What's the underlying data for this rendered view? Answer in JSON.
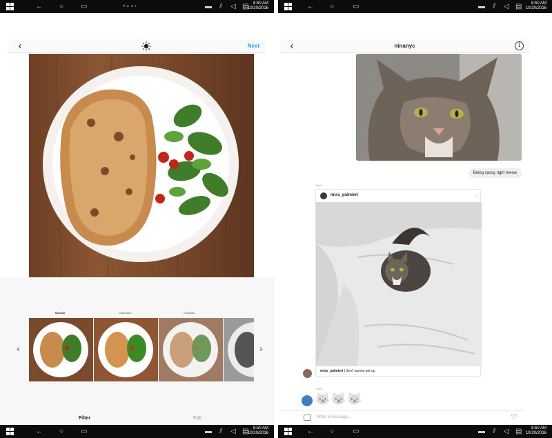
{
  "left_screen": {
    "taskbar_top": {
      "time": "8:50 AM",
      "date": "10/20/2016"
    },
    "taskbar_bottom": {
      "time": "8:50 AM",
      "date": "10/20/2016"
    },
    "header": {
      "back_icon": "chevron-left-icon",
      "center_icon": "sun-adjust-icon",
      "next_label": "Next"
    },
    "filters": [
      {
        "name": "Normal",
        "active": true
      },
      {
        "name": "Clarendon",
        "active": false
      },
      {
        "name": "Gingham",
        "active": false
      },
      {
        "name": "",
        "active": false
      }
    ],
    "tabs": {
      "filter_label": "Filter",
      "edit_label": "Edit"
    }
  },
  "right_screen": {
    "taskbar_top": {
      "time": "8:50 AM",
      "date": "10/20/2016"
    },
    "taskbar_bottom": {
      "time": "8:50 AM",
      "date": "10/20/2016"
    },
    "header": {
      "back_icon": "chevron-left-icon",
      "title": "ninanyc",
      "info_icon": "info-icon"
    },
    "message_bubble": "Being sassy right meow",
    "shared_label": "Seen",
    "shared_post": {
      "username": "miss_palmieri",
      "caption_user": "miss_palmieri",
      "caption_text": "I don't wanna get up"
    },
    "reaction_label": "Seen",
    "reactions": [
      "😼",
      "😼",
      "😼"
    ],
    "compose": {
      "placeholder": "Write a message...",
      "camera_icon": "camera-icon",
      "heart_icon": "heart-icon"
    }
  },
  "colors": {
    "accent": "#3897f0",
    "taskbar": "#0c0c0c",
    "wood": "#7a4a2c"
  }
}
